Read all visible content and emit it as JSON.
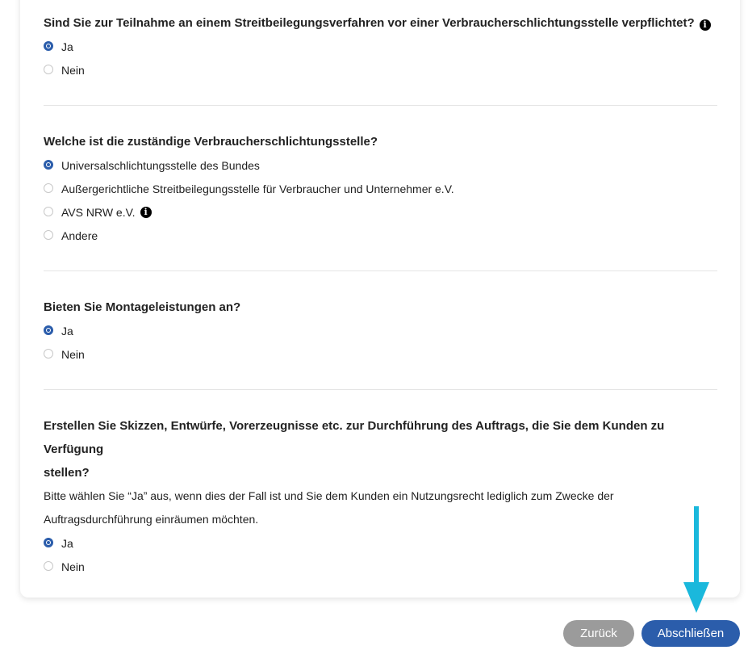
{
  "sections": [
    {
      "question": "Sind Sie zur Teilnahme an einem Streitbeilegungsverfahren vor einer Verbraucherschlichtungsstelle verpflichtet?",
      "options": [
        {
          "label": "Ja",
          "selected": true
        },
        {
          "label": "Nein",
          "selected": false
        }
      ]
    },
    {
      "question": "Welche ist die zuständige Verbraucherschlichtungsstelle?",
      "options": [
        {
          "label": "Universalschlichtungsstelle des Bundes",
          "selected": true
        },
        {
          "label": "Außergerichtliche Streitbeilegungsstelle für Verbraucher und Unternehmer e.V.",
          "selected": false
        },
        {
          "label": "AVS NRW e.V.",
          "selected": false
        },
        {
          "label": "Andere",
          "selected": false
        }
      ]
    },
    {
      "question": "Bieten Sie Montageleistungen an?",
      "options": [
        {
          "label": "Ja",
          "selected": true
        },
        {
          "label": "Nein",
          "selected": false
        }
      ]
    },
    {
      "question_line1": "Erstellen Sie Skizzen, Entwürfe, Vorerzeugnisse etc. zur Durchführung des Auftrags, die Sie dem Kunden zu Verfügung",
      "question_line2": "stellen?",
      "hint_line1": "Bitte wählen Sie “Ja” aus, wenn dies der Fall ist und Sie dem Kunden ein Nutzungsrecht lediglich zum Zwecke der",
      "hint_line2": "Auftragsdurchführung einräumen möchten.",
      "options": [
        {
          "label": "Ja",
          "selected": true
        },
        {
          "label": "Nein",
          "selected": false
        }
      ]
    }
  ],
  "info_icon_glyph": "i",
  "buttons": {
    "back": "Zurück",
    "finish": "Abschließen"
  },
  "colors": {
    "accent": "#2b5dab",
    "back_button": "#9b9b9b",
    "arrow": "#1ab8dc"
  }
}
